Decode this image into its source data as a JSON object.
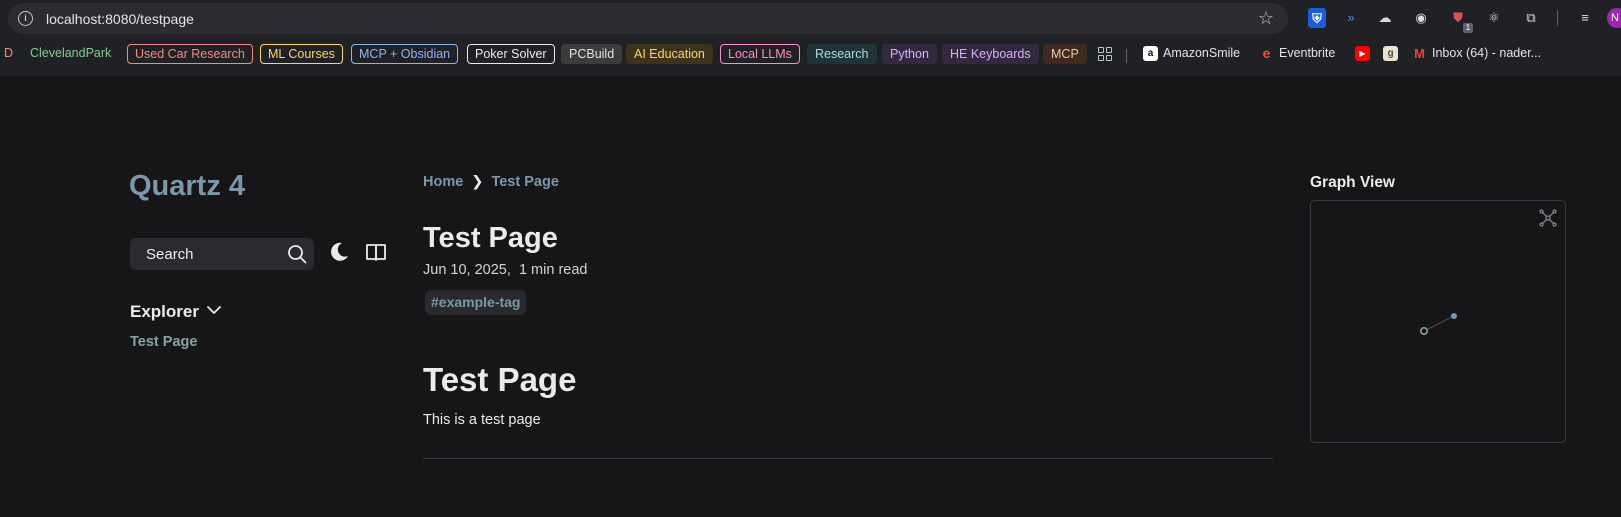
{
  "browser": {
    "url": "localhost:8080/testpage",
    "extensions": [
      "bitwarden-icon",
      "wifi-like-icon",
      "cloud-icon",
      "spy-icon",
      "ublock-icon",
      "react-devtools-icon",
      "puzzle-icon",
      "media-queue-icon"
    ],
    "avatar_letter": "N"
  },
  "bookmarks": [
    {
      "label": "D",
      "style": "plain-red"
    },
    {
      "label": "ClevelandPark",
      "style": "plain-green"
    },
    {
      "label": "Used Car Research",
      "style": "outline",
      "color": "#f28b82"
    },
    {
      "label": "ML Courses",
      "style": "outline",
      "color": "#fdd663"
    },
    {
      "label": "MCP + Obsidian",
      "style": "outline",
      "color": "#8ab4f8"
    },
    {
      "label": "Poker Solver",
      "style": "outline",
      "color": "#e8eaed"
    },
    {
      "label": "PCBuild",
      "style": "fill",
      "color": "#3c3c3f"
    },
    {
      "label": "AI Education",
      "style": "fill",
      "color": "#4a3c1c"
    },
    {
      "label": "Local LLMs",
      "style": "outline",
      "color": "#ff8bcb"
    },
    {
      "label": "Research",
      "style": "fill",
      "color": "#1d3a3f"
    },
    {
      "label": "Python",
      "style": "fill",
      "color": "#3a2a4a"
    },
    {
      "label": "HE Keyboards",
      "style": "fill",
      "color": "#3a2a4a"
    },
    {
      "label": "MCP",
      "style": "fill",
      "color": "#4a2e1e"
    },
    {
      "label": "AmazonSmile",
      "style": "site"
    },
    {
      "label": "Eventbrite",
      "style": "site"
    },
    {
      "label": "Inbox (64) - nader...",
      "style": "site"
    }
  ],
  "site": {
    "title": "Quartz 4",
    "search_label": "Search",
    "explorer_title": "Explorer",
    "explorer_items": [
      "Test Page"
    ]
  },
  "article": {
    "breadcrumb": [
      "Home",
      "Test Page"
    ],
    "title": "Test Page",
    "date": "Jun 10, 2025",
    "read_time": "1 min read",
    "tag": "#example-tag",
    "heading": "Test Page",
    "body": "This is a test page"
  },
  "graph": {
    "title": "Graph View",
    "colors": {
      "node": "#7b97aa",
      "current": "#84a59d",
      "edge": "#4a4a4e"
    }
  }
}
